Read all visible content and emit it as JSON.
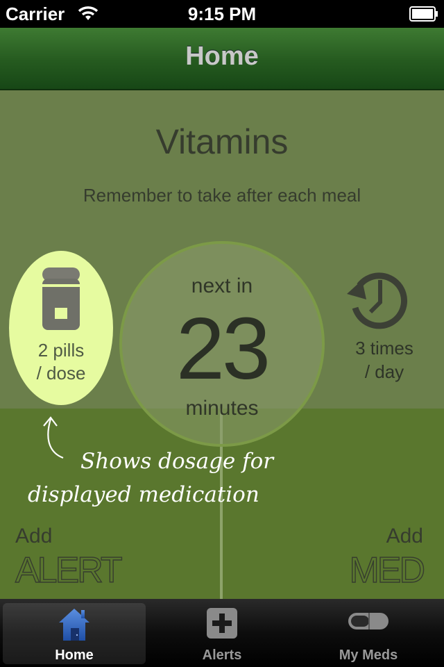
{
  "status_bar": {
    "carrier": "Carrier",
    "time": "9:15 PM"
  },
  "nav": {
    "title": "Home"
  },
  "medication": {
    "name": "Vitamins",
    "note": "Remember to take after each meal"
  },
  "countdown": {
    "label_top": "next in",
    "value": "23",
    "label_bottom": "minutes"
  },
  "dosage": {
    "line1": "2 pills",
    "line2": "/ dose"
  },
  "frequency": {
    "line1": "3 times",
    "line2": "/ day"
  },
  "hint": {
    "line1": "Shows dosage for",
    "line2": "displayed medication"
  },
  "actions": {
    "add_alert_small": "Add",
    "add_alert_big": "ALERT",
    "add_med_small": "Add",
    "add_med_big": "MED"
  },
  "tabs": [
    {
      "label": "Home",
      "icon": "home-icon",
      "selected": true
    },
    {
      "label": "Alerts",
      "icon": "plus-icon",
      "selected": false
    },
    {
      "label": "My Meds",
      "icon": "pill-capsule-icon",
      "selected": false
    }
  ],
  "colors": {
    "nav_green": "#255a1f",
    "content_top": "#6b7f4b",
    "content_bottom": "#5a772e",
    "dosage_highlight": "#e6fba0"
  }
}
